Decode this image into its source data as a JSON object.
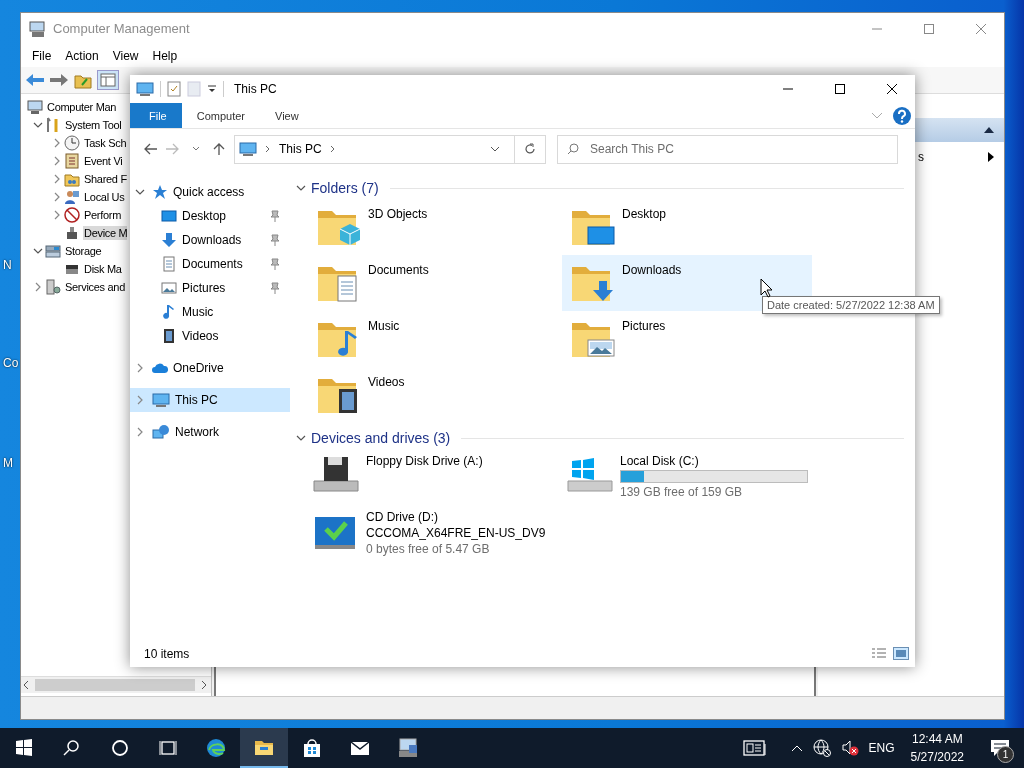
{
  "desktop_icons": [
    {
      "label": "N"
    },
    {
      "label": "Co"
    },
    {
      "label": "M"
    }
  ],
  "computer_management": {
    "title": "Computer Management",
    "menu": [
      "File",
      "Action",
      "View",
      "Help"
    ],
    "tree": [
      {
        "label": "Computer Man",
        "selected": false,
        "children": [
          {
            "label": "System Tool",
            "kind": "branch",
            "expanded": true,
            "selected": false,
            "children": [
              {
                "label": "Task Sch",
                "kind": "branch",
                "expanded": false,
                "selected": false
              },
              {
                "label": "Event Vi",
                "kind": "branch",
                "expanded": false,
                "selected": false
              },
              {
                "label": "Shared F",
                "kind": "branch",
                "expanded": false,
                "selected": false
              },
              {
                "label": "Local Us",
                "kind": "branch",
                "expanded": false,
                "selected": false
              },
              {
                "label": "Perform",
                "kind": "branch",
                "expanded": false,
                "selected": false
              },
              {
                "label": "Device M",
                "kind": "leaf",
                "selected": true
              }
            ]
          },
          {
            "label": "Storage",
            "kind": "branch",
            "expanded": true,
            "selected": false,
            "children": [
              {
                "label": "Disk Ma",
                "kind": "leaf",
                "selected": false
              }
            ]
          },
          {
            "label": "Services and",
            "kind": "branch",
            "expanded": false,
            "selected": false
          }
        ]
      }
    ],
    "actions": [
      {
        "label": "s"
      }
    ]
  },
  "explorer": {
    "title": "This PC",
    "tabs": [
      {
        "label": "File",
        "kind": "menu"
      },
      {
        "label": "Computer",
        "kind": "tab"
      },
      {
        "label": "View",
        "kind": "tab"
      }
    ],
    "address": [
      "This PC"
    ],
    "search": {
      "placeholder": "Search This PC"
    },
    "nav": [
      {
        "label": "Quick access",
        "expanded": true,
        "selected": false,
        "children": [
          {
            "label": "Desktop",
            "pinned": true
          },
          {
            "label": "Downloads",
            "pinned": true
          },
          {
            "label": "Documents",
            "pinned": true
          },
          {
            "label": "Pictures",
            "pinned": true
          },
          {
            "label": "Music",
            "pinned": false
          },
          {
            "label": "Videos",
            "pinned": false
          }
        ]
      },
      {
        "label": "OneDrive",
        "expanded": false,
        "selected": false
      },
      {
        "label": "This PC",
        "expanded": false,
        "selected": true
      },
      {
        "label": "Network",
        "expanded": false,
        "selected": false
      }
    ],
    "folders": {
      "title": "Folders (7)",
      "expanded": true,
      "items": [
        {
          "name": "3D Objects",
          "hovered": false
        },
        {
          "name": "Desktop",
          "hovered": false
        },
        {
          "name": "Documents",
          "hovered": false
        },
        {
          "name": "Downloads",
          "hovered": true
        },
        {
          "name": "Music",
          "hovered": false
        },
        {
          "name": "Pictures",
          "hovered": false
        },
        {
          "name": "Videos",
          "hovered": false
        }
      ]
    },
    "drives": {
      "title": "Devices and drives (3)",
      "expanded": true,
      "items": [
        {
          "name": "Floppy Disk Drive (A:)",
          "kind": "plain"
        },
        {
          "name": "Local Disk (C:)",
          "kind": "usage",
          "level": 0.126,
          "free": "139 GB free of 159 GB"
        },
        {
          "name": "CD Drive (D:)",
          "kind": "media",
          "label": "CCCOMA_X64FRE_EN-US_DV9",
          "free": "0 bytes free of 5.47 GB"
        }
      ]
    },
    "tooltip": "Date created: 5/27/2022 12:38 AM",
    "status": "10 items"
  },
  "taskbar": {
    "apps": [
      {
        "active": false
      },
      {
        "active": true
      },
      {
        "active": false
      },
      {
        "active": false
      },
      {
        "active": false
      }
    ],
    "language": "ENG",
    "time": "12:44 AM",
    "date": "5/27/2022",
    "notifications": "1"
  }
}
